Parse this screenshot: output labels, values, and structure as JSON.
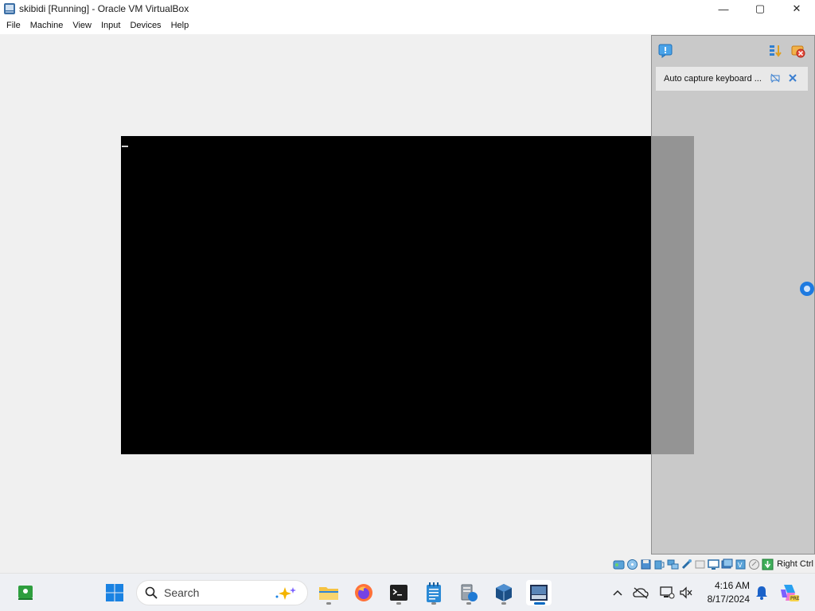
{
  "window": {
    "title": "skibidi [Running] - Oracle VM VirtualBox",
    "controls": {
      "minimize": "—",
      "maximize": "▢",
      "close": "✕"
    }
  },
  "menu": [
    "File",
    "Machine",
    "View",
    "Input",
    "Devices",
    "Help"
  ],
  "notification_center": {
    "message": "Auto capture keyboard ..."
  },
  "statusbar": {
    "host_key": "Right Ctrl"
  },
  "taskbar": {
    "search_placeholder": "Search",
    "time": "4:16 AM",
    "date": "8/17/2024",
    "pinned_apps": [
      "file-explorer",
      "firefox",
      "terminal",
      "notepad",
      "server-manager",
      "virtualbox",
      "vm-window"
    ]
  },
  "colors": {
    "vm_screen": "#000000",
    "accent": "#0067c0",
    "panel": "#bebebe"
  }
}
